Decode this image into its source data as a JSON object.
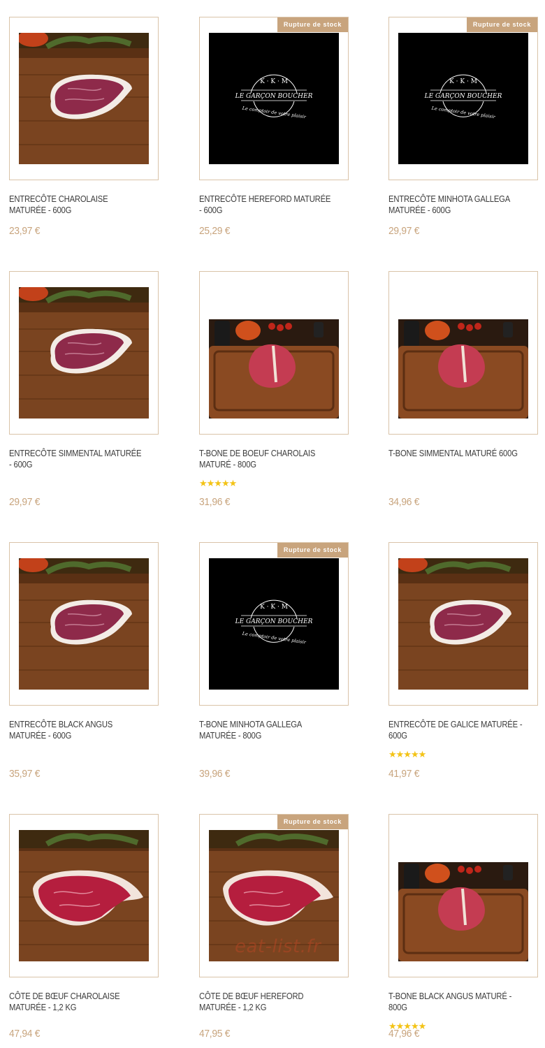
{
  "products": [
    {
      "title": "Entrecôte Charolaise Maturée - 600g",
      "price": "23,97 €",
      "badge": "",
      "image": "ribeye-board",
      "stars": ""
    },
    {
      "title": "Entrecôte Hereford Maturée - 600g",
      "price": "25,29 €",
      "badge": "Rupture de stock",
      "image": "logo-placeholder",
      "stars": ""
    },
    {
      "title": "Entrecôte Minhota Gallega Maturée - 600g",
      "price": "29,97 €",
      "badge": "Rupture de stock",
      "image": "logo-placeholder",
      "stars": ""
    },
    {
      "title": "Entrecôte Simmental Maturée - 600g",
      "price": "29,97 €",
      "badge": "",
      "image": "ribeye-board",
      "stars": ""
    },
    {
      "title": "T-bone de boeuf Charolais Maturé - 800g",
      "price": "31,96 €",
      "badge": "",
      "image": "tbone-board",
      "stars": "★★★★★"
    },
    {
      "title": "T-bone Simmental Maturé 600g",
      "price": "34,96 €",
      "badge": "",
      "image": "tbone-board",
      "stars": ""
    },
    {
      "title": "Entrecôte Black Angus Maturée - 600g",
      "price": "35,97 €",
      "badge": "",
      "image": "ribeye-board",
      "stars": ""
    },
    {
      "title": "T-bone Minhota Gallega Maturée - 800g",
      "price": "39,96 €",
      "badge": "Rupture de stock",
      "image": "logo-placeholder",
      "stars": ""
    },
    {
      "title": "Entrecôte de Galice Maturée - 600g",
      "price": "41,97 €",
      "badge": "",
      "image": "ribeye-board",
      "stars": "★★★★★"
    },
    {
      "title": "Côte de bœuf Charolaise Maturée - 1,2 kg",
      "price": "47,94 €",
      "badge": "",
      "image": "rib-steak-board",
      "stars": ""
    },
    {
      "title": "Côte de bœuf Hereford Maturée - 1,2 kg",
      "price": "47,95 €",
      "badge": "Rupture de stock",
      "image": "rib-steak-board",
      "stars": ""
    },
    {
      "title": "T-bone Black Angus Maturé - 800g",
      "price": "47,96 €",
      "badge": "",
      "image": "tbone-board",
      "stars": "★★★★★"
    }
  ],
  "logo": {
    "initials": "K · K · M",
    "name": "LE GARÇON BOUCHER",
    "tagline": "Le comptoir de votre plaisir"
  },
  "watermark": "eat-list.fr",
  "colors": {
    "accent": "#c8a47d",
    "star": "#f3c316",
    "border": "#d9c3a8",
    "text": "#3c3c3c"
  }
}
